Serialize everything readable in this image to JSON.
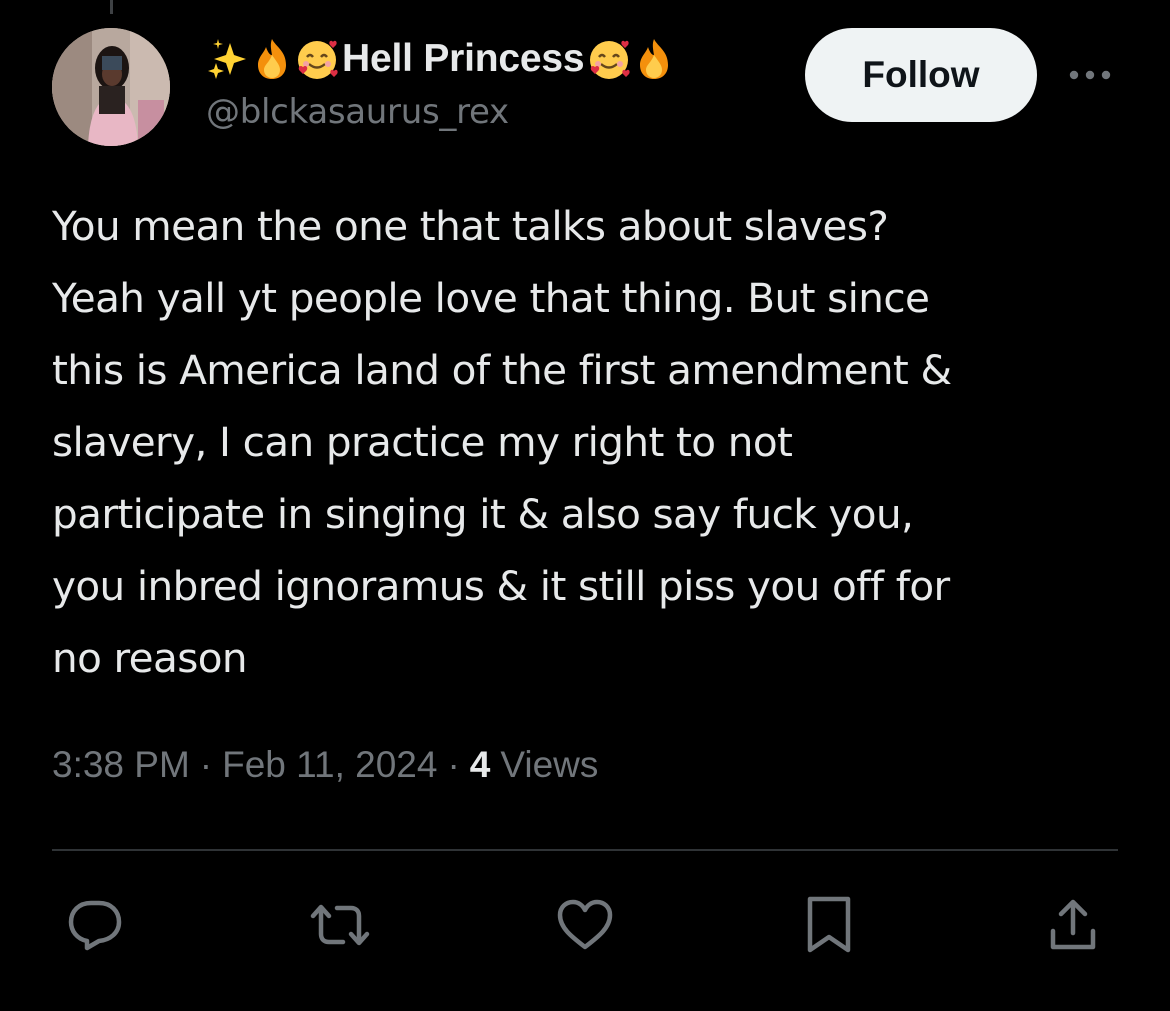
{
  "author": {
    "name_prefix_emojis": [
      "sparkles-emoji",
      "fire-emoji",
      "smiling-face-with-hearts-emoji"
    ],
    "display_name": "Hell Princess",
    "name_suffix_emojis": [
      "smiling-face-with-hearts-emoji",
      "fire-emoji"
    ],
    "handle": "@blckasaurus_rex",
    "avatar": "avatar-photo"
  },
  "header": {
    "follow_label": "Follow",
    "more_icon": "more-horizontal-icon"
  },
  "tweet": {
    "lines": [
      "You mean the one that talks about slaves?",
      "Yeah yall yt people love that thing. But since",
      "this is America land of the first amendment &",
      "slavery, I can practice my right to not",
      "participate in singing it & also say fuck you,",
      "you inbred ignoramus & it still piss you off for",
      "no reason"
    ]
  },
  "meta": {
    "time": "3:38 PM",
    "separator": "·",
    "date": "Feb 11, 2024",
    "views_count": "4",
    "views_label": "Views"
  },
  "actions": [
    "reply-icon",
    "retweet-icon",
    "like-icon",
    "bookmark-icon",
    "share-icon"
  ],
  "colors": {
    "background": "#000000",
    "text": "#e7e9ea",
    "secondary": "#71767b",
    "divider": "#2f3336",
    "follow_bg": "#eff3f4"
  }
}
